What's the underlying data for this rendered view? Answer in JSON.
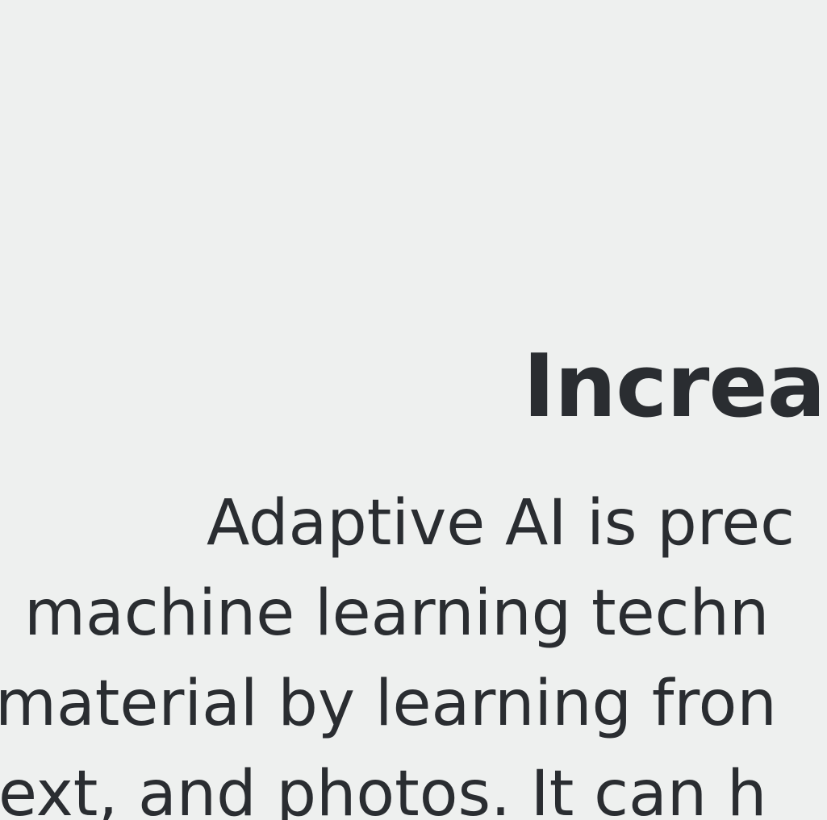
{
  "section": {
    "heading": "Increa",
    "body_lines": [
      "Adaptive AI is prec",
      "machine learning techn",
      "material by learning fron",
      "ext, and photos. It can h"
    ]
  },
  "colors": {
    "background": "#eef0ef",
    "text": "#2a2d31"
  }
}
